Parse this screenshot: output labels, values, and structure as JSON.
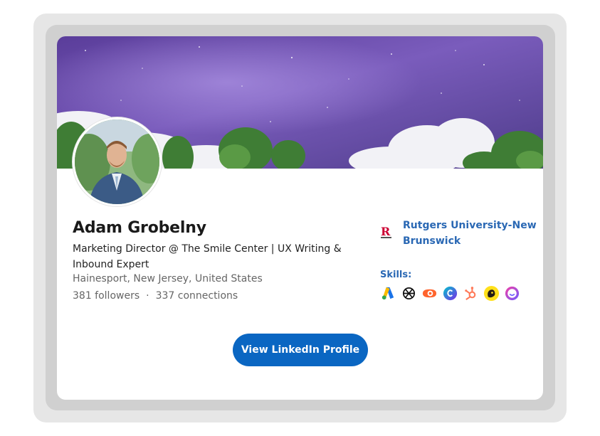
{
  "profile": {
    "name": "Adam Grobelny",
    "headline": "Marketing Director @ The Smile Center | UX Writing & Inbound Expert",
    "location": "Hainesport, New Jersey, United States",
    "followers": "381 followers",
    "separator": "·",
    "connections": "337 connections"
  },
  "education": {
    "school": "Rutgers University-New Brunswick",
    "logo_icon": "rutgers-logo-icon"
  },
  "skills": {
    "label": "Skills:",
    "icons": [
      "google-ads-icon",
      "openai-icon",
      "semrush-icon",
      "canva-icon",
      "hubspot-icon",
      "mailchimp-icon",
      "jasper-icon"
    ]
  },
  "cta": {
    "label": "View LinkedIn Profile"
  },
  "colors": {
    "accent": "#0a66c2",
    "link": "#2a68b4",
    "banner_sky": "#6a4fa8"
  }
}
